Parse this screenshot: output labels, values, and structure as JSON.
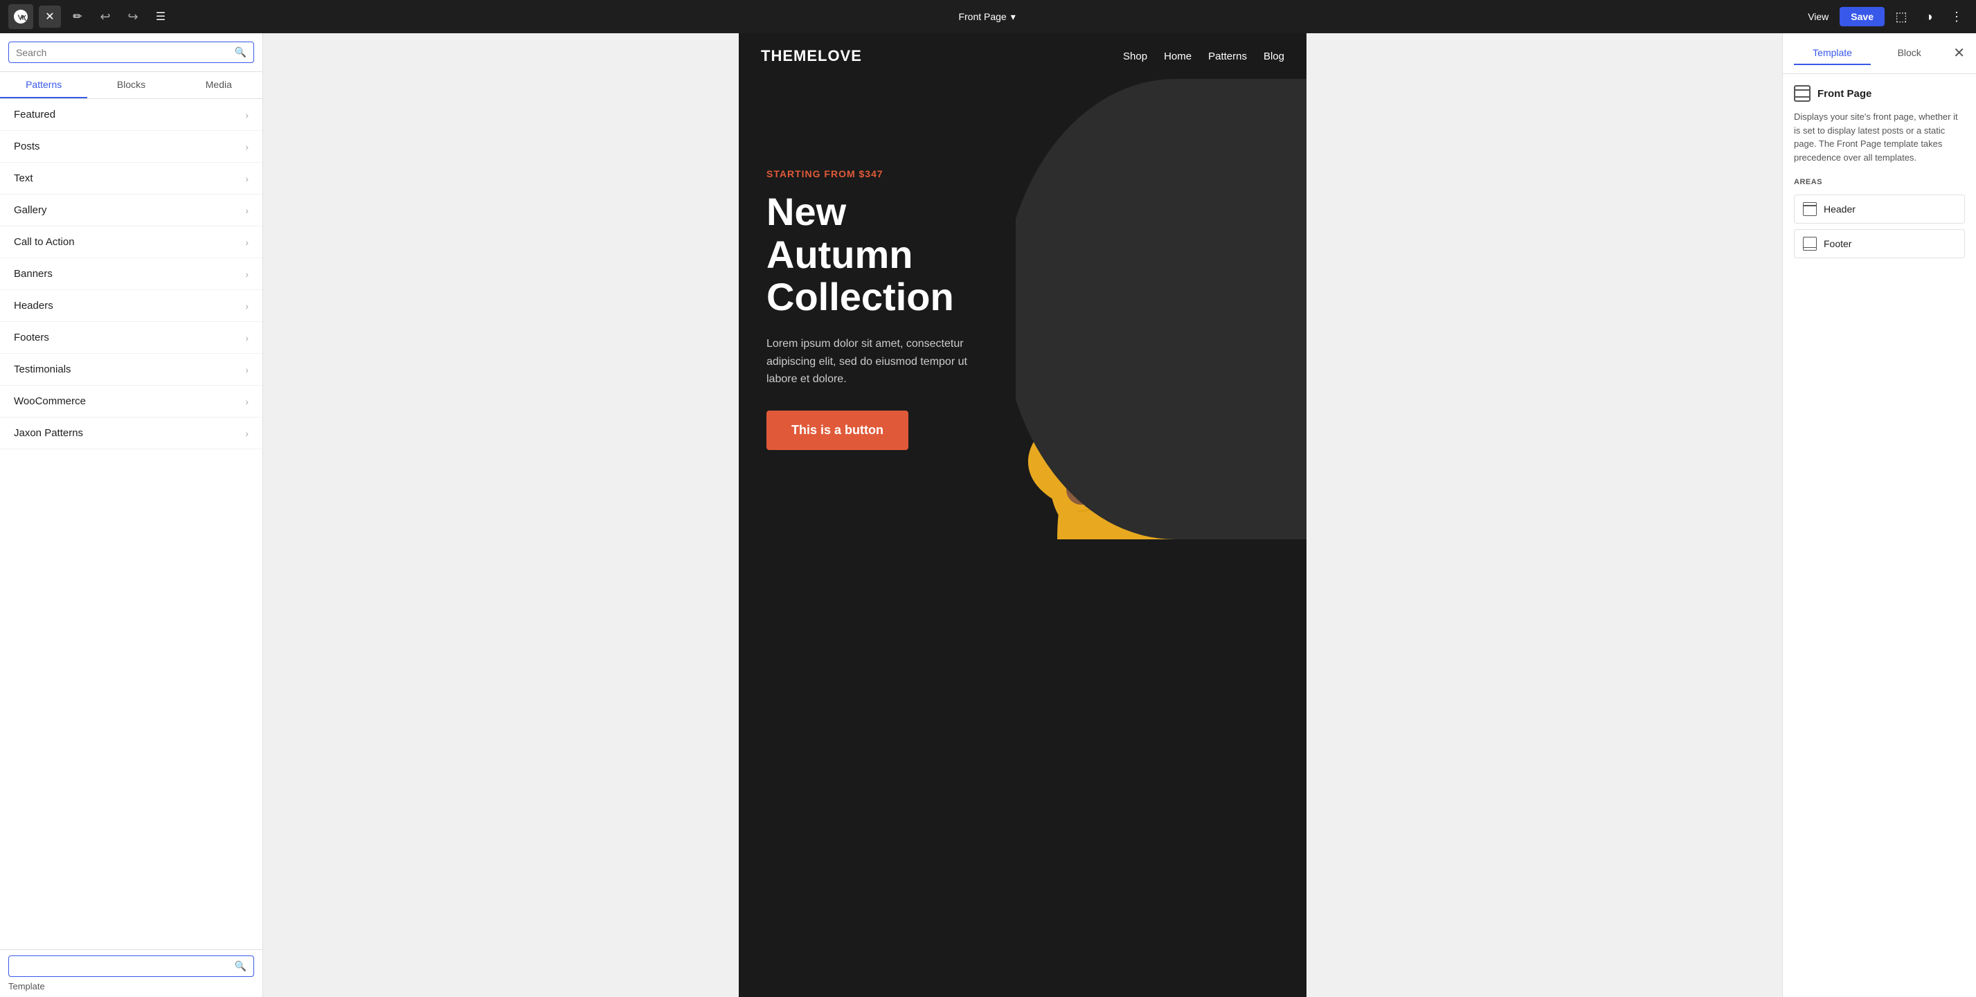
{
  "topbar": {
    "page_title": "Front Page",
    "view_label": "View",
    "save_label": "Save"
  },
  "left_sidebar": {
    "search_placeholder": "Search",
    "tabs": [
      {
        "id": "patterns",
        "label": "Patterns",
        "active": true
      },
      {
        "id": "blocks",
        "label": "Blocks",
        "active": false
      },
      {
        "id": "media",
        "label": "Media",
        "active": false
      }
    ],
    "pattern_items": [
      {
        "id": "featured",
        "label": "Featured"
      },
      {
        "id": "posts",
        "label": "Posts"
      },
      {
        "id": "text",
        "label": "Text"
      },
      {
        "id": "gallery",
        "label": "Gallery"
      },
      {
        "id": "call-to-action",
        "label": "Call to Action"
      },
      {
        "id": "banners",
        "label": "Banners"
      },
      {
        "id": "headers",
        "label": "Headers"
      },
      {
        "id": "footers",
        "label": "Footers"
      },
      {
        "id": "testimonials",
        "label": "Testimonials"
      },
      {
        "id": "woocommerce",
        "label": "WooCommerce"
      },
      {
        "id": "jaxon-patterns",
        "label": "Jaxon Patterns"
      }
    ],
    "bottom_label": "Template"
  },
  "canvas": {
    "site_logo": "THEMELOVE",
    "nav_items": [
      "Shop",
      "Home",
      "Patterns",
      "Blog"
    ],
    "hero": {
      "eyebrow": "STARTING FROM $347",
      "title": "New Autumn Collection",
      "description": "Lorem ipsum dolor sit amet, consectetur adipiscing elit, sed do eiusmod tempor ut labore et dolore.",
      "button_label": "This is a button"
    }
  },
  "right_sidebar": {
    "tabs": [
      {
        "id": "template",
        "label": "Template",
        "active": true
      },
      {
        "id": "block",
        "label": "Block",
        "active": false
      }
    ],
    "template_name": "Front Page",
    "template_description": "Displays your site's front page, whether it is set to display latest posts or a static page. The Front Page template takes precedence over all templates.",
    "areas_label": "AREAS",
    "areas": [
      {
        "id": "header",
        "label": "Header"
      },
      {
        "id": "footer",
        "label": "Footer"
      }
    ]
  }
}
